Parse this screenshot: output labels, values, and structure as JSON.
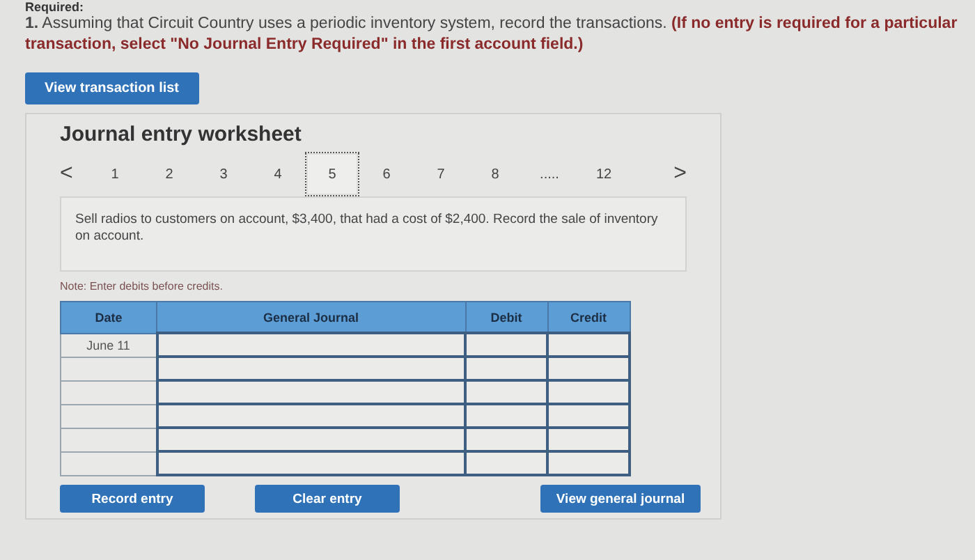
{
  "heading": "Required:",
  "question": {
    "number": "1.",
    "text": "Assuming that Circuit Country uses a periodic inventory system, record the transactions.",
    "instruction": "(If no entry is required for a particular transaction, select \"No Journal Entry Required\" in the first account field.)"
  },
  "transaction_list_button": "View transaction list",
  "worksheet": {
    "title": "Journal entry worksheet",
    "pager": {
      "prev": "<",
      "next": ">",
      "pages": [
        {
          "label": "1",
          "selected": false
        },
        {
          "label": "2",
          "selected": false
        },
        {
          "label": "3",
          "selected": false
        },
        {
          "label": "4",
          "selected": false
        },
        {
          "label": "5",
          "selected": true
        },
        {
          "label": "6",
          "selected": false
        },
        {
          "label": "7",
          "selected": false
        },
        {
          "label": "8",
          "selected": false
        },
        {
          "label": ".....",
          "selected": false
        },
        {
          "label": "12",
          "selected": false
        }
      ]
    },
    "description": "Sell radios to customers on account, $3,400, that had a cost of $2,400. Record the sale of inventory on account.",
    "note": "Note: Enter debits before credits.",
    "table": {
      "columns": [
        "Date",
        "General Journal",
        "Debit",
        "Credit"
      ],
      "rows": [
        {
          "date": "June 11"
        },
        {},
        {},
        {},
        {},
        {}
      ]
    },
    "buttons": [
      "Record entry",
      "Clear entry",
      "View general journal"
    ]
  }
}
